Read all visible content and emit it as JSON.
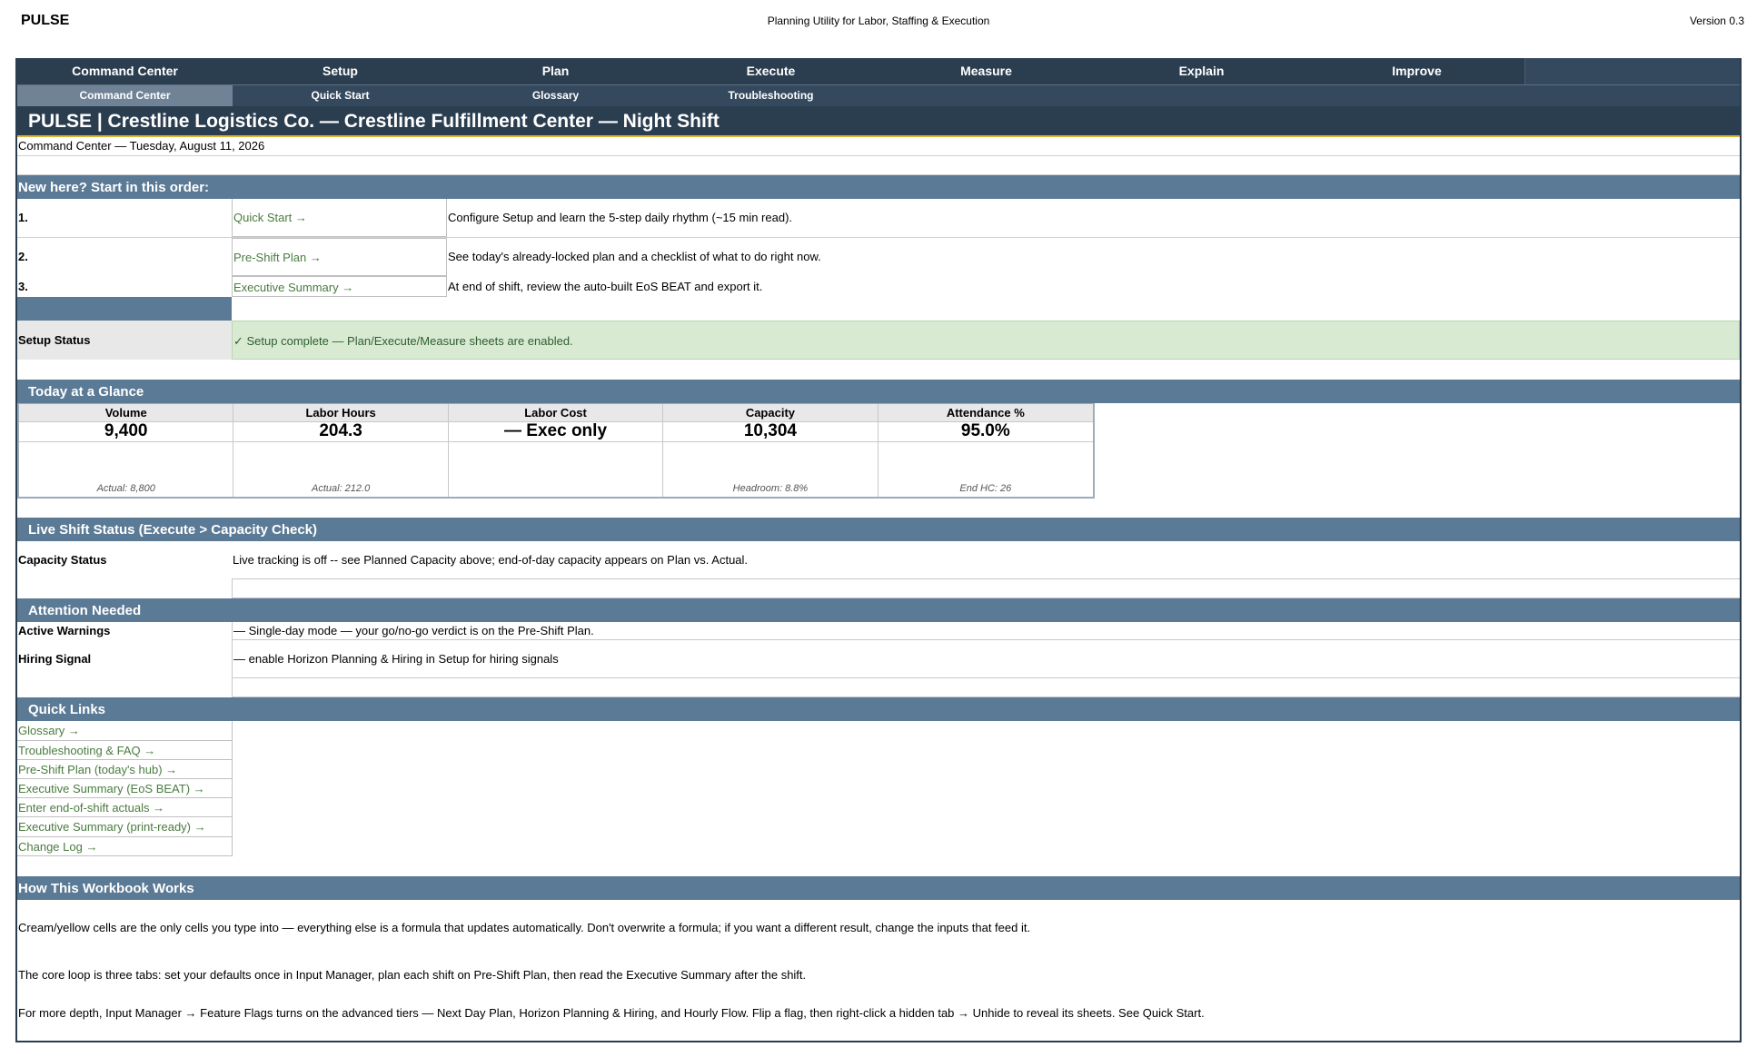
{
  "doc": {
    "logo": "PULSE",
    "subtitle": "Planning Utility for Labor, Staffing & Execution",
    "version": "Version 0.3"
  },
  "nav": {
    "main": [
      "Command Center",
      "Setup",
      "Plan",
      "Execute",
      "Measure",
      "Explain",
      "Improve"
    ],
    "sub": [
      "Command Center",
      "Quick Start",
      "Glossary",
      "Troubleshooting"
    ]
  },
  "title": "PULSE | Crestline Logistics Co. — Crestline Fulfillment Center — Night Shift",
  "date_line": "Command Center — Tuesday, August 11, 2026",
  "start": {
    "heading": "New here? Start in this order:",
    "steps": [
      {
        "num": "1.",
        "link": "Quick Start →",
        "desc": "Configure Setup and learn the 5-step daily rhythm (~15 min read)."
      },
      {
        "num": "2.",
        "link": "Pre-Shift Plan →",
        "desc": "See today's already-locked plan and a checklist of what to do right now."
      },
      {
        "num": "3.",
        "link": "Executive Summary →",
        "desc": "At end of shift, review the auto-built EoS BEAT and export it."
      }
    ]
  },
  "setup_status": {
    "label": "Setup Status",
    "value": "✓ Setup complete — Plan/Execute/Measure sheets are enabled.",
    "color": "#d9ead3"
  },
  "glance": {
    "heading": "Today at a Glance",
    "kpis": [
      {
        "label": "Volume",
        "value": "9,400",
        "note": "Actual: 8,800"
      },
      {
        "label": "Labor Hours",
        "value": "204.3",
        "note": "Actual: 212.0"
      },
      {
        "label": "Labor Cost",
        "value": "— Exec only",
        "note": ""
      },
      {
        "label": "Capacity",
        "value": "10,304",
        "note": "Headroom: 8.8%"
      },
      {
        "label": "Attendance %",
        "value": "95.0%",
        "note": "End HC: 26"
      }
    ]
  },
  "live": {
    "heading": "Live Shift Status (Execute > Capacity Check)",
    "label": "Capacity Status",
    "text": "Live tracking is off -- see Planned Capacity above; end-of-day capacity appears on Plan vs. Actual."
  },
  "attention": {
    "heading": "Attention Needed",
    "rows": [
      {
        "label": "Active Warnings",
        "text": "— Single-day mode — your go/no-go verdict is on the Pre-Shift Plan."
      },
      {
        "label": "Hiring Signal",
        "text": "— enable Horizon Planning & Hiring in Setup for hiring signals"
      }
    ]
  },
  "quick_links": {
    "heading": "Quick Links",
    "items": [
      "Glossary →",
      "Troubleshooting & FAQ →",
      "Pre-Shift Plan (today's hub) →",
      "Executive Summary (EoS BEAT) →",
      "Enter end-of-shift actuals →",
      "Executive Summary (print-ready) →",
      "Change Log →"
    ]
  },
  "how": {
    "heading": "How This Workbook Works",
    "paragraphs": [
      "Cream/yellow cells are the only cells you type into — everything else is a formula that updates automatically. Don't overwrite a formula; if you want a different result, change the inputs that feed it.",
      "The core loop is three tabs: set your defaults once in Input Manager, plan each shift on Pre-Shift Plan, then read the Executive Summary after the shift.",
      "For more depth, Input Manager → Feature Flags turns on the advanced tiers — Next Day Plan, Horizon Planning & Hiring, and Hourly Flow. Flip a flag, then right-click a hidden tab → Unhide to reveal its sheets. See Quick Start."
    ]
  },
  "colors": {
    "nav_dark": "#2b3e50",
    "section": "#5b7a96",
    "link": "#4a7c40",
    "accent": "#e0b23a"
  }
}
